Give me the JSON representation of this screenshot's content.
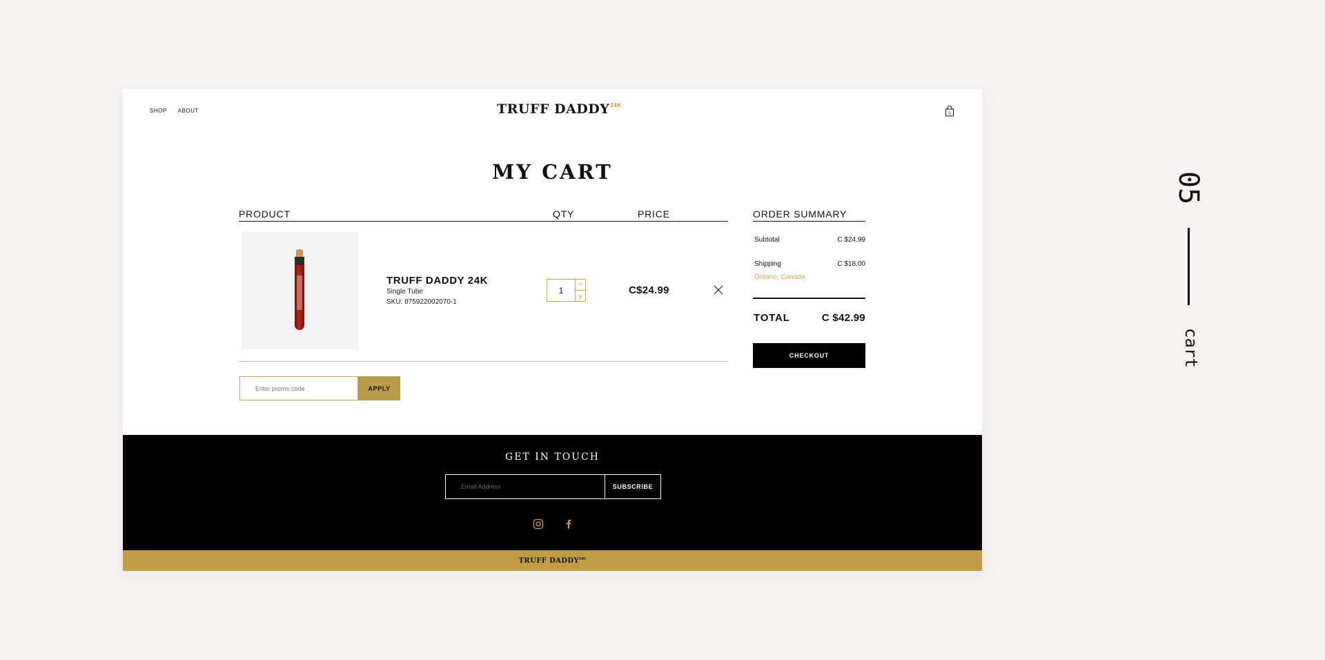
{
  "nav": {
    "shop": "SHOP",
    "about": "ABOUT"
  },
  "brand": {
    "name": "TRUFF DADDY",
    "mark": "24K"
  },
  "header": {
    "cart_icon": "shopping-bag-icon"
  },
  "page": {
    "title": "MY CART"
  },
  "cart": {
    "columns": {
      "product": "PRODUCT",
      "qty": "QTY",
      "price": "PRICE"
    },
    "item": {
      "name": "TRUFF DADDY 24K",
      "variant": "Single Tube",
      "sku": "SKU: 875922002070-1",
      "quantity": "1",
      "qty_up": "^",
      "qty_down": "v",
      "price": "C$24.99",
      "remove_icon": "close-icon"
    },
    "promo": {
      "placeholder": "Enter promo code",
      "apply": "APPLY"
    }
  },
  "summary": {
    "title": "ORDER SUMMARY",
    "subtotal_label": "Subtotal",
    "subtotal_value": "C $24.99",
    "shipping_label": "Shipping",
    "shipping_value": "C $18.00",
    "shipping_location": "Ontario, Canada",
    "total_label": "TOTAL",
    "total_value": "C $42.99",
    "checkout": "CHECKOUT"
  },
  "footer": {
    "heading": "GET IN TOUCH",
    "email_placeholder": "Email Address",
    "subscribe": "SUBSCRIBE",
    "social": [
      "instagram-icon",
      "facebook-icon"
    ],
    "bottom_brand": "TRUFF DADDY",
    "bottom_mark": "24K"
  },
  "annotation": {
    "number": "05",
    "word": "cart"
  },
  "colors": {
    "gold": "#c09c47",
    "black": "#000000",
    "background": "#f6f2f0"
  }
}
